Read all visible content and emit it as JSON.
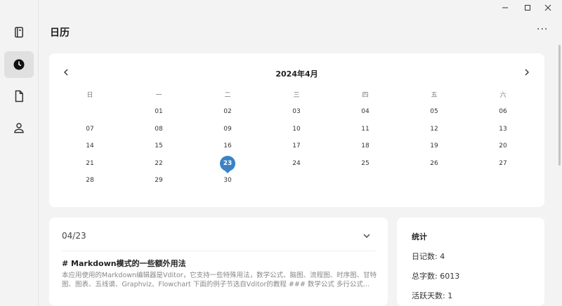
{
  "page": {
    "title": "日历",
    "more_label": "···"
  },
  "sidebar": {
    "items": [
      {
        "name": "notebook",
        "icon": "notebook-icon"
      },
      {
        "name": "calendar",
        "icon": "clock-icon",
        "active": true
      },
      {
        "name": "file",
        "icon": "file-icon"
      },
      {
        "name": "user",
        "icon": "user-icon"
      }
    ]
  },
  "window_controls": [
    "minimize-icon",
    "maximize-icon",
    "close-icon"
  ],
  "calendar": {
    "month_label": "2024年4月",
    "weekdays": [
      "日",
      "一",
      "二",
      "三",
      "四",
      "五",
      "六"
    ],
    "first_weekday": 1,
    "days": [
      "01",
      "02",
      "03",
      "04",
      "05",
      "06",
      "07",
      "08",
      "09",
      "10",
      "11",
      "12",
      "13",
      "14",
      "15",
      "16",
      "17",
      "18",
      "19",
      "20",
      "21",
      "22",
      "23",
      "24",
      "25",
      "26",
      "27",
      "28",
      "29",
      "30"
    ],
    "selected": "23",
    "accent_color": "#3a82c4"
  },
  "entry": {
    "date": "04/23",
    "title": "# Markdown模式的一些额外用法",
    "preview": "本应用使用的Markdown编辑器是Vditor，它支持一些特殊用法，数学公式、脑图、流程图、时序图、甘特图、图表、五线谱、Graphviz、Flowchart 下面的例子节选自Vditor的教程 ### 数学公式 多行公式..."
  },
  "stats": {
    "title": "统计",
    "entries": "日记数: 4",
    "words": "总字数: 6013",
    "active_days": "活跃天数: 1"
  }
}
